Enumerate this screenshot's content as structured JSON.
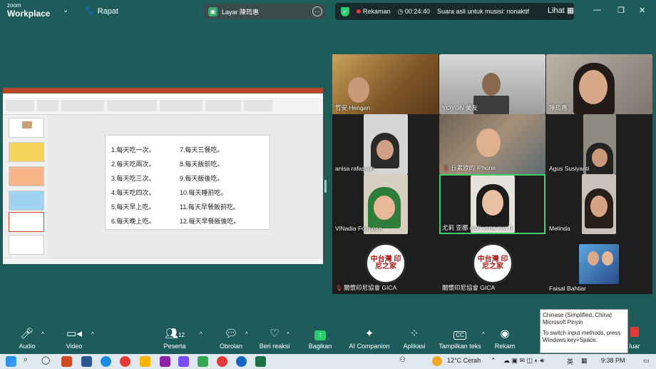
{
  "topbar": {
    "brand_top": "zoom",
    "brand_bottom": "Workplace",
    "meeting_label": "Rapat",
    "share_label": "Layar 陳筠惠",
    "recording_label": "Rekaman",
    "timer": "00:24:40",
    "audio_setting": "Suara asli untuk musisi: nonaktif",
    "view_label": "Lihat"
  },
  "slide": {
    "col1": [
      "1.每天吃一次。",
      "2.每天吃兩次。",
      "3.每天吃三次。",
      "4.每天吃四次。",
      "5.每天早上吃。",
      "6.每天晚上吃。"
    ],
    "col2": [
      "7.每天三餐吃。",
      "8.每天飯前吃。",
      "9.每天飯後吃。",
      "10.每天睡前吃。",
      "11.每天早餐飯前吃。",
      "12.每天早餐飯後吃。"
    ]
  },
  "participants": [
    {
      "name": "哲安 Hengan",
      "muted": false
    },
    {
      "name": "YOYON 美友",
      "muted": false
    },
    {
      "name": "陳筠惠",
      "muted": false
    },
    {
      "name": "anisa rafasyah",
      "muted": false
    },
    {
      "name": "丘素欣的 iPhone",
      "muted": true
    },
    {
      "name": "Agus Susiyanti",
      "muted": false
    },
    {
      "name": "ViNadia Formosa",
      "muted": false
    },
    {
      "name": "尤莉 亚娜 (yuli yana eva.f)",
      "muted": false
    },
    {
      "name": "Melinda",
      "muted": false
    },
    {
      "name": "關懷印尼協會 GICA",
      "muted": true
    },
    {
      "name": "關懷印尼協會 GICA",
      "muted": false
    },
    {
      "name": "Faisal Bahtiar",
      "muted": false
    }
  ],
  "logo_text": "中台灣 印尼之家",
  "toolbar": {
    "audio": "Audio",
    "video": "Video",
    "participants": "Peserta",
    "participant_count": "12",
    "chat": "Obrolan",
    "reactions": "Beri reaksi",
    "share": "Bagikan",
    "ai": "AI Companion",
    "apps": "Aplikasi",
    "captions": "Tampilkan teks",
    "record": "Rekam",
    "leave": "luar"
  },
  "ime_tooltip": {
    "line1": "Chinese (Simplified, China)",
    "line2": "Microsoft Pinyin",
    "line3": "To switch input methods, press Windows key+Space."
  },
  "taskbar": {
    "weather": "12°C Cerah",
    "lang": "英",
    "time": "9:38 PM"
  },
  "colors": {
    "background": "#1e5c5c",
    "active_speaker": "#3ecf6b",
    "recording": "#e53935",
    "share_green": "#3aa66b"
  }
}
